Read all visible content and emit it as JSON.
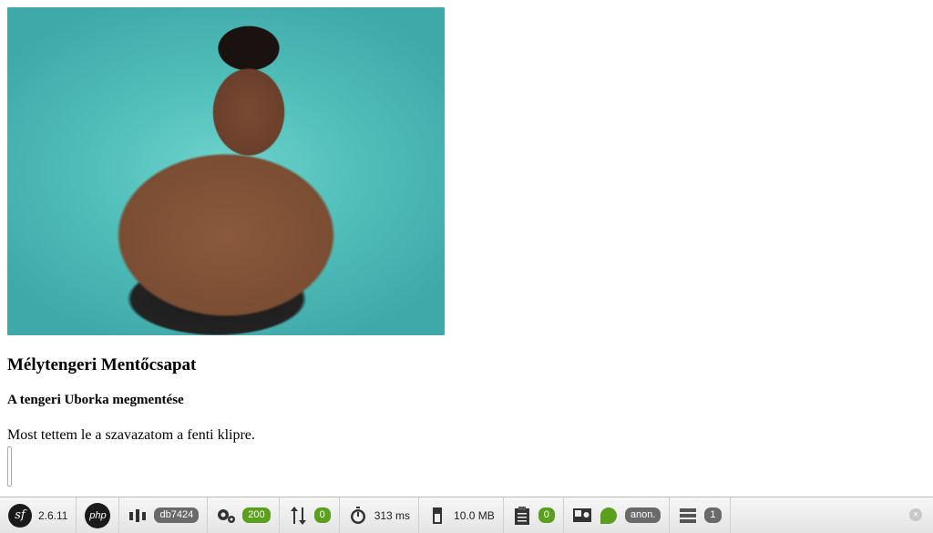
{
  "article": {
    "title": "Mélytengeri Mentőcsapat",
    "subtitle": "A tengeri Uborka megmentése",
    "body": "Most tettem le a szavazatom a fenti klipre."
  },
  "toolbar": {
    "version": "2.6.11",
    "php_label": "php",
    "db_name": "db7424",
    "status_code": "200",
    "ajax_count": "0",
    "time": "313 ms",
    "memory": "10.0 MB",
    "logs_count": "0",
    "user": "anon.",
    "db_queries": "1",
    "icons": [
      "symfony-icon",
      "php-icon",
      "config-icon",
      "gears-icon",
      "ajax-icon",
      "timer-icon",
      "memory-icon",
      "clipboard-icon",
      "security-icon",
      "db-icon",
      "close-icon"
    ],
    "colors": {
      "green": "#5aa01c",
      "grey_badge": "#6a6a6a"
    }
  }
}
